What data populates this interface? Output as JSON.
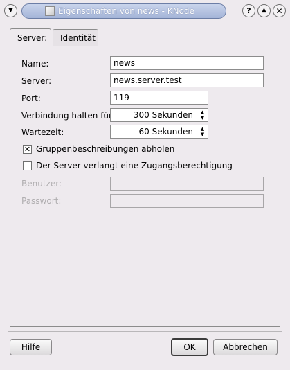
{
  "window": {
    "title": "Eigenschaften von news - KNode",
    "menu_icon": "chevron-down-icon",
    "help_symbol": "?",
    "maximize_symbol": "▲",
    "close_symbol": "✕"
  },
  "tabs": [
    {
      "label": "Server:",
      "selected": true
    },
    {
      "label": "Identität",
      "selected": false
    }
  ],
  "form": {
    "name_label": "Name:",
    "name_value": "news",
    "server_label": "Server:",
    "server_value": "news.server.test",
    "port_label": "Port:",
    "port_value": "119",
    "keepalive_label": "Verbindung halten für:",
    "keepalive_value": "300 Sekunden",
    "timeout_label": "Wartezeit:",
    "timeout_value": "60 Sekunden",
    "fetch_descriptions_label": "Gruppenbeschreibungen abholen",
    "fetch_descriptions_checked": true,
    "requires_auth_label": "Der Server verlangt eine Zugangsberechtigung",
    "requires_auth_checked": false,
    "user_label": "Benutzer:",
    "user_value": "",
    "password_label": "Passwort:",
    "password_value": ""
  },
  "buttons": {
    "help": "Hilfe",
    "ok": "OK",
    "cancel": "Abbrechen"
  }
}
